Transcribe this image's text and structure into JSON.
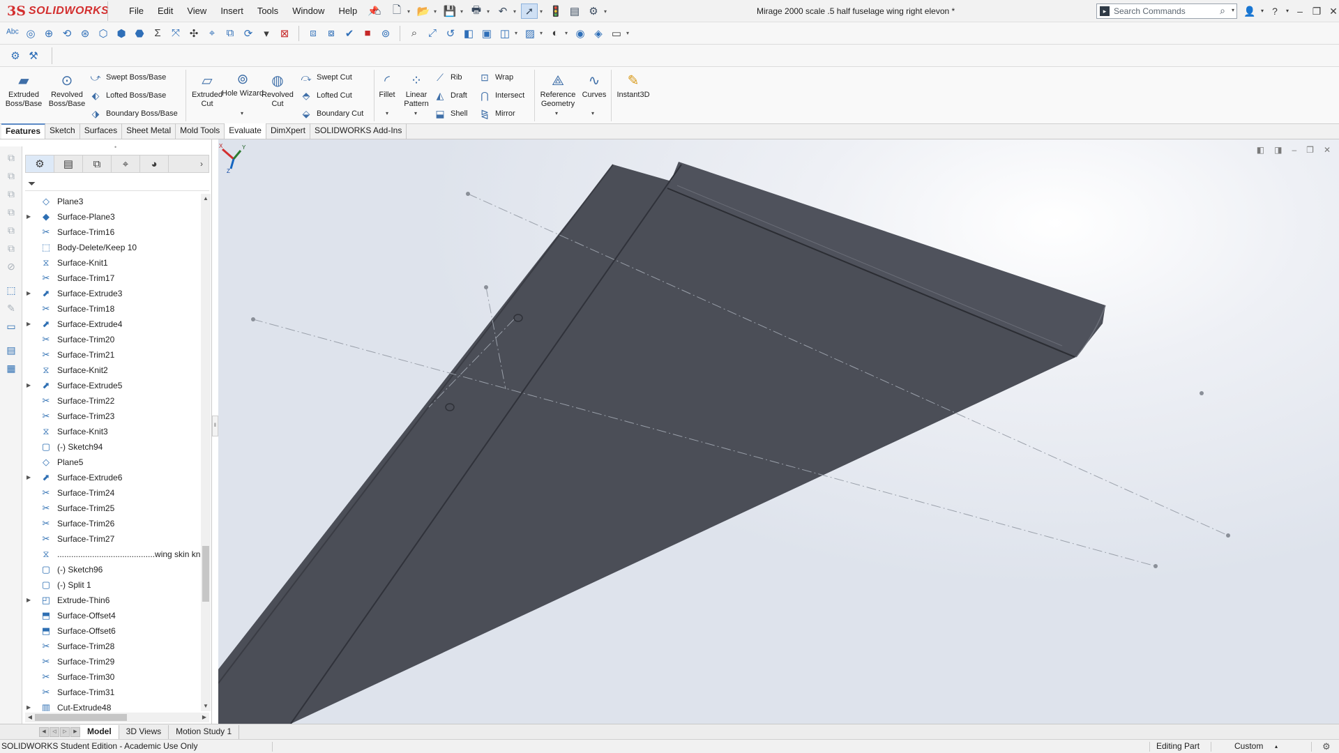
{
  "app": {
    "logo_ds": "3S",
    "logo_text": "SOLIDWORKS",
    "document_title": "Mirage 2000 scale .5 half fuselage wing right  elevon *"
  },
  "menu": [
    "File",
    "Edit",
    "View",
    "Insert",
    "Tools",
    "Window",
    "Help"
  ],
  "search": {
    "placeholder": "Search Commands"
  },
  "ribbon": {
    "extruded_boss": "Extruded Boss/Base",
    "revolved_boss": "Revolved Boss/Base",
    "swept_boss": "Swept Boss/Base",
    "lofted_boss": "Lofted Boss/Base",
    "boundary_boss": "Boundary Boss/Base",
    "extruded_cut": "Extruded Cut",
    "hole_wizard": "Hole Wizard",
    "revolved_cut": "Revolved Cut",
    "swept_cut": "Swept Cut",
    "lofted_cut": "Lofted Cut",
    "boundary_cut": "Boundary Cut",
    "fillet": "Fillet",
    "linear_pattern": "Linear Pattern",
    "rib": "Rib",
    "draft": "Draft",
    "shell": "Shell",
    "wrap": "Wrap",
    "intersect": "Intersect",
    "mirror": "Mirror",
    "reference_geometry": "Reference Geometry",
    "curves": "Curves",
    "instant3d": "Instant3D"
  },
  "command_tabs": [
    "Features",
    "Sketch",
    "Surfaces",
    "Sheet Metal",
    "Mold Tools",
    "Evaluate",
    "DimXpert",
    "SOLIDWORKS Add-Ins"
  ],
  "tree": [
    {
      "label": "Plane3",
      "icon": "plane-icon",
      "expandable": false
    },
    {
      "label": "Surface-Plane3",
      "icon": "surface-plane-icon",
      "expandable": true
    },
    {
      "label": "Surface-Trim16",
      "icon": "surface-trim-icon",
      "expandable": false
    },
    {
      "label": "Body-Delete/Keep 10",
      "icon": "body-delete-icon",
      "expandable": false
    },
    {
      "label": "Surface-Knit1",
      "icon": "surface-knit-icon",
      "expandable": false
    },
    {
      "label": "Surface-Trim17",
      "icon": "surface-trim-icon",
      "expandable": false
    },
    {
      "label": "Surface-Extrude3",
      "icon": "surface-extrude-icon",
      "expandable": true
    },
    {
      "label": "Surface-Trim18",
      "icon": "surface-trim-icon",
      "expandable": false
    },
    {
      "label": "Surface-Extrude4",
      "icon": "surface-extrude-icon",
      "expandable": true
    },
    {
      "label": "Surface-Trim20",
      "icon": "surface-trim-icon",
      "expandable": false
    },
    {
      "label": "Surface-Trim21",
      "icon": "surface-trim-icon",
      "expandable": false
    },
    {
      "label": "Surface-Knit2",
      "icon": "surface-knit-icon",
      "expandable": false
    },
    {
      "label": "Surface-Extrude5",
      "icon": "surface-extrude-icon",
      "expandable": true
    },
    {
      "label": "Surface-Trim22",
      "icon": "surface-trim-icon",
      "expandable": false
    },
    {
      "label": "Surface-Trim23",
      "icon": "surface-trim-icon",
      "expandable": false
    },
    {
      "label": "Surface-Knit3",
      "icon": "surface-knit-icon",
      "expandable": false
    },
    {
      "label": "(-) Sketch94",
      "icon": "sketch-icon",
      "expandable": false
    },
    {
      "label": "Plane5",
      "icon": "plane-icon",
      "expandable": false
    },
    {
      "label": "Surface-Extrude6",
      "icon": "surface-extrude-icon",
      "expandable": true
    },
    {
      "label": "Surface-Trim24",
      "icon": "surface-trim-icon",
      "expandable": false
    },
    {
      "label": "Surface-Trim25",
      "icon": "surface-trim-icon",
      "expandable": false
    },
    {
      "label": "Surface-Trim26",
      "icon": "surface-trim-icon",
      "expandable": false
    },
    {
      "label": "Surface-Trim27",
      "icon": "surface-trim-icon",
      "expandable": false
    },
    {
      "label": "..........................................wing skin knit",
      "icon": "surface-knit-icon",
      "expandable": false
    },
    {
      "label": "(-) Sketch96",
      "icon": "sketch-icon",
      "expandable": false
    },
    {
      "label": "(-) Split 1",
      "icon": "sketch-icon",
      "expandable": false
    },
    {
      "label": "Extrude-Thin6",
      "icon": "extrude-thin-icon",
      "expandable": true
    },
    {
      "label": "Surface-Offset4",
      "icon": "surface-offset-icon",
      "expandable": false
    },
    {
      "label": "Surface-Offset6",
      "icon": "surface-offset-icon",
      "expandable": false
    },
    {
      "label": "Surface-Trim28",
      "icon": "surface-trim-icon",
      "expandable": false
    },
    {
      "label": "Surface-Trim29",
      "icon": "surface-trim-icon",
      "expandable": false
    },
    {
      "label": "Surface-Trim30",
      "icon": "surface-trim-icon",
      "expandable": false
    },
    {
      "label": "Surface-Trim31",
      "icon": "surface-trim-icon",
      "expandable": false
    },
    {
      "label": "Cut-Extrude48",
      "icon": "cut-extrude-icon",
      "expandable": true
    }
  ],
  "bottom_tabs": [
    "Model",
    "3D Views",
    "Motion Study 1"
  ],
  "status": {
    "left": "SOLIDWORKS Student Edition - Academic Use Only",
    "editing": "Editing Part",
    "units": "Custom"
  },
  "triad": {
    "x": "X",
    "y": "Y",
    "z": "Z"
  },
  "colors": {
    "brand_red": "#d32f2f",
    "part_body": "#4b4e57",
    "accent_blue": "#2e6fb3"
  }
}
